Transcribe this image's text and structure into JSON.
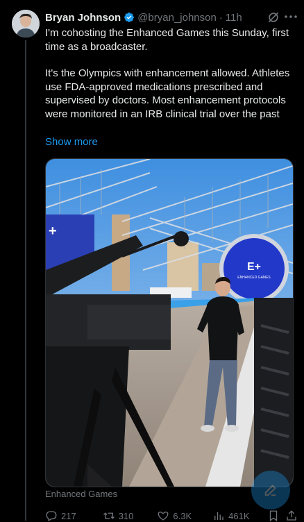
{
  "author": {
    "name": "Bryan Johnson",
    "handle": "@bryan_johnson",
    "separator": "·",
    "time": "11h"
  },
  "icons": [
    "verified-badge-icon",
    "grok-icon",
    "more-icon",
    "reply-icon",
    "repost-icon",
    "like-icon",
    "views-icon",
    "bookmark-icon",
    "share-icon",
    "compose-icon"
  ],
  "post": {
    "paragraph1": "I'm cohosting the Enhanced Games this Sunday, first time as a broadcaster.",
    "paragraph2": "It's the Olympics with enhancement allowed. Athletes use FDA-approved medications prescribed and supervised by doctors. Most enhancement protocols were monitored in an IRB clinical trial over the past",
    "show_more": "Show more"
  },
  "media": {
    "sign_logo": "E+",
    "sign_text": "ENHANCED GAMES"
  },
  "source_label": "Enhanced Games",
  "stats": {
    "replies": "217",
    "reposts": "310",
    "likes": "6.3K",
    "views": "461K"
  },
  "colors": {
    "background": "#000000",
    "text": "#e7e9ea",
    "muted": "#71767b",
    "accent": "#1d9bf0"
  }
}
